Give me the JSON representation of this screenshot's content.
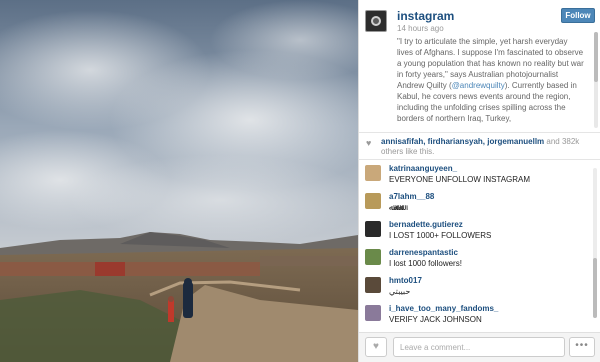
{
  "post": {
    "username": "instagram",
    "time": "14 hours ago",
    "follow_label": "Follow",
    "caption_before": "\"I try to articulate the simple, yet harsh everyday lives of Afghans. I suppose I'm fascinated to observe a young population that has known no reality but war in forty years,\" says Australian photojournalist Andrew Quilty (",
    "caption_handle": "@andrewquilty",
    "caption_after": "). Currently based in Kabul, he covers news events around the region, including the unfolding crises spilling across the borders of northern Iraq, Turkey,"
  },
  "likes": {
    "names": "annisafifah, firdhariansyah, jorgemanuellm",
    "rest": " and 382k others like this."
  },
  "comments": [
    {
      "user": "katrinaanguyeen_",
      "text": "EVERYONE UNFOLLOW INSTAGRAM",
      "avatar_color": "#c9a87a"
    },
    {
      "user": "a7lahm__88",
      "text": "ﷲﷲﷲ",
      "avatar_color": "#b89a5a"
    },
    {
      "user": "bernadette.gutierez",
      "text": "I LOST 1000+ FOLLOWERS",
      "avatar_color": "#2a2a2a"
    },
    {
      "user": "darrenespantastic",
      "text": "I lost 1000 followers!",
      "avatar_color": "#6a8a4a"
    },
    {
      "user": "hmto017",
      "text": "حبيبتي",
      "avatar_color": "#5a4a3a"
    },
    {
      "user": "i_have_too_many_fandoms_",
      "text": "VERIFY JACK JOHNSON",
      "avatar_color": "#8a7a9a"
    }
  ],
  "footer": {
    "comment_placeholder": "Leave a comment...",
    "more_label": "•••",
    "like_icon": "♥"
  }
}
